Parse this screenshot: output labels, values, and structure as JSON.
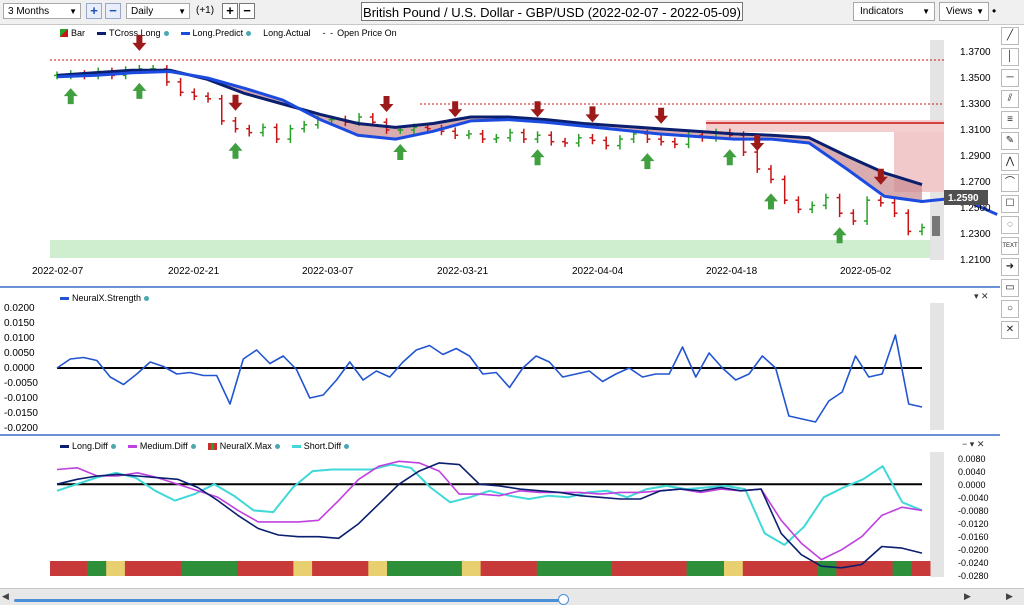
{
  "toolbar": {
    "period": "3 Months",
    "interval": "Daily",
    "offset": "(+1)",
    "title": "British Pound / U.S. Dollar - GBP/USD (2022-02-07 - 2022-05-09)",
    "indicators_label": "Indicators",
    "views_label": "Views"
  },
  "price_panel": {
    "legend": [
      "Bar",
      "TCross.Long",
      "Long.Predict",
      "Long.Actual",
      "Open Price On"
    ],
    "current_price_label": "1.2590",
    "y_ticks": [
      "1.3700",
      "1.3500",
      "1.3300",
      "1.3100",
      "1.2900",
      "1.2700",
      "1.2500",
      "1.2300",
      "1.2100"
    ],
    "x_ticks": [
      "2022-02-07",
      "2022-02-21",
      "2022-03-07",
      "2022-03-21",
      "2022-04-04",
      "2022-04-18",
      "2022-05-02"
    ]
  },
  "strength_panel": {
    "legend": "NeuralX.Strength",
    "y_ticks": [
      "0.0200",
      "0.0150",
      "0.0100",
      "0.0050",
      "0.0000",
      "-0.0050",
      "-0.0100",
      "-0.0150",
      "-0.0200"
    ]
  },
  "diff_panel": {
    "legend": [
      "Long.Diff",
      "Medium.Diff",
      "NeuralX.Max",
      "Short.Diff"
    ],
    "y_ticks": [
      "0.0080",
      "0.0040",
      "0.0000",
      "-0.0040",
      "-0.0080",
      "-0.0120",
      "-0.0160",
      "-0.0200",
      "-0.0240",
      "-0.0280"
    ]
  },
  "colors": {
    "tcross": "#0a1f6e",
    "predict": "#1c4be0",
    "strength": "#2255d0",
    "medium": "#c040e0",
    "short": "#40d8d8",
    "bear": "#c81414",
    "bull": "#2aa02a"
  },
  "chart_data": [
    {
      "type": "candlestick",
      "title": "British Pound / U.S. Dollar - GBP/USD (2022-02-07 - 2022-05-09)",
      "x": [
        "2022-02-07",
        "2022-02-21",
        "2022-03-07",
        "2022-03-21",
        "2022-04-04",
        "2022-04-18",
        "2022-05-02"
      ],
      "ylim": [
        1.21,
        1.37
      ],
      "series": [
        {
          "name": "TCross.Long",
          "values": [
            1.352,
            1.354,
            1.356,
            1.356,
            1.349,
            1.338,
            1.33,
            1.322,
            1.315,
            1.312,
            1.315,
            1.32,
            1.32,
            1.318,
            1.315,
            1.313,
            1.311,
            1.309,
            1.307,
            1.306,
            1.304,
            1.29,
            1.277,
            1.268
          ]
        },
        {
          "name": "Long.Predict",
          "values": [
            1.351,
            1.352,
            1.354,
            1.355,
            1.35,
            1.342,
            1.333,
            1.318,
            1.306,
            1.303,
            1.309,
            1.317,
            1.318,
            1.316,
            1.313,
            1.31,
            1.307,
            1.305,
            1.303,
            1.303,
            1.3,
            1.28,
            1.259,
            1.255,
            1.258,
            1.245
          ]
        },
        {
          "name": "Close",
          "values": [
            1.352,
            1.353,
            1.352,
            1.355,
            1.352,
            1.356,
            1.357,
            1.357,
            1.347,
            1.339,
            1.336,
            1.334,
            1.317,
            1.311,
            1.308,
            1.312,
            1.303,
            1.311,
            1.314,
            1.318,
            1.318,
            1.316,
            1.32,
            1.316,
            1.31,
            1.31,
            1.312,
            1.311,
            1.309,
            1.306,
            1.307,
            1.303,
            1.304,
            1.308,
            1.303,
            1.306,
            1.301,
            1.3,
            1.304,
            1.302,
            1.298,
            1.303,
            1.307,
            1.303,
            1.301,
            1.299,
            1.306,
            1.304,
            1.308,
            1.306,
            1.293,
            1.28,
            1.272,
            1.256,
            1.249,
            1.252,
            1.258,
            1.246,
            1.24,
            1.256,
            1.254,
            1.246,
            1.232,
            1.235
          ]
        }
      ]
    },
    {
      "type": "line",
      "series": [
        {
          "name": "NeuralX.Strength",
          "values": [
            0,
            0.003,
            0.0035,
            0.0025,
            -0.003,
            -0.0055,
            -0.002,
            0.002,
            0.0005,
            -0.002,
            -0.0015,
            -0.0025,
            -0.0025,
            -0.012,
            0.003,
            0.006,
            0.0015,
            0.004,
            -0.0005,
            -0.01,
            -0.009,
            -0.004,
            0.002,
            -0.004,
            -0.001,
            -0.003,
            0.002,
            0.006,
            0.0075,
            0.0045,
            0.0065,
            0.004,
            -0.002,
            -0.0015,
            -0.0065,
            0,
            0.004,
            0.002,
            -0.003,
            -0.002,
            -0.001,
            -0.0045,
            -0.002,
            0,
            -0.003,
            -0.002,
            -0.002,
            0.007,
            -0.003,
            0.005,
            0,
            -0.004,
            -0.002,
            0.004,
            0,
            -0.016,
            -0.017,
            -0.018,
            -0.011,
            -0.008,
            0.004,
            -0.003,
            -0.002,
            0.011,
            -0.012,
            -0.013
          ]
        }
      ]
    },
    {
      "type": "line",
      "series": [
        {
          "name": "Long.Diff",
          "values": [
            0,
            0.0015,
            0.0025,
            0.003,
            0.0025,
            0.002,
            0.0015,
            -0.001,
            -0.005,
            -0.0095,
            -0.0135,
            -0.0155,
            -0.016,
            -0.016,
            -0.0165,
            -0.012,
            -0.006,
            0,
            0.004,
            0.0065,
            0.006,
            0,
            -0.0005,
            -0.0015,
            -0.002,
            -0.0025,
            -0.0035,
            -0.004,
            -0.0045,
            -0.0045,
            -0.002,
            -0.0015,
            -0.002,
            -0.001,
            -0.002,
            -0.0015,
            -0.015,
            -0.0215,
            -0.025,
            -0.0255,
            -0.0245,
            -0.019,
            -0.0195,
            -0.021
          ]
        },
        {
          "name": "Medium.Diff",
          "values": [
            0.0045,
            0.005,
            0.0025,
            0.0025,
            0.0035,
            0.002,
            0,
            -0.002,
            -0.004,
            -0.008,
            -0.0115,
            -0.0115,
            -0.0115,
            -0.011,
            -0.005,
            0.0015,
            0.0055,
            0.007,
            0.0065,
            0.004,
            -0.003,
            -0.003,
            -0.0035,
            -0.002,
            -0.0025,
            -0.0025,
            -0.0025,
            -0.003,
            -0.0025,
            -0.0025,
            -0.002,
            -0.0015,
            -0.0025,
            -0.0015,
            -0.002,
            -0.0015,
            -0.011,
            -0.018,
            -0.023,
            -0.02,
            -0.016,
            -0.0095,
            -0.007,
            -0.008
          ]
        },
        {
          "name": "Short.Diff",
          "values": [
            -0.002,
            0,
            0.002,
            0.0035,
            0.002,
            -0.002,
            -0.005,
            -0.003,
            0,
            -0.0035,
            -0.008,
            -0.0085,
            -0.001,
            0.004,
            0.0045,
            0.0045,
            0.0045,
            0.006,
            0.005,
            -0.001,
            -0.0055,
            -0.004,
            -0.002,
            -0.0035,
            -0.0045,
            -0.0035,
            -0.004,
            -0.0025,
            -0.002,
            -0.004,
            -0.0015,
            -0.0005,
            -0.0015,
            -0.001,
            -0.0005,
            -0.0015,
            -0.015,
            -0.0185,
            -0.013,
            -0.004,
            -0.001,
            0.0015,
            0.0055,
            -0.0055,
            -0.008
          ]
        },
        {
          "name": "NeuralX.Max",
          "values": [
            "red",
            "red",
            "green",
            "yellow",
            "red",
            "red",
            "red",
            "green",
            "green",
            "green",
            "red",
            "red",
            "red",
            "yellow",
            "red",
            "red",
            "red",
            "yellow",
            "green",
            "green",
            "green",
            "green",
            "yellow",
            "red",
            "red",
            "red",
            "green",
            "green",
            "green",
            "green",
            "red",
            "red",
            "red",
            "red",
            "green",
            "green",
            "yellow",
            "red",
            "red",
            "red",
            "red",
            "green",
            "red",
            "red",
            "red",
            "green",
            "red"
          ]
        }
      ]
    }
  ]
}
